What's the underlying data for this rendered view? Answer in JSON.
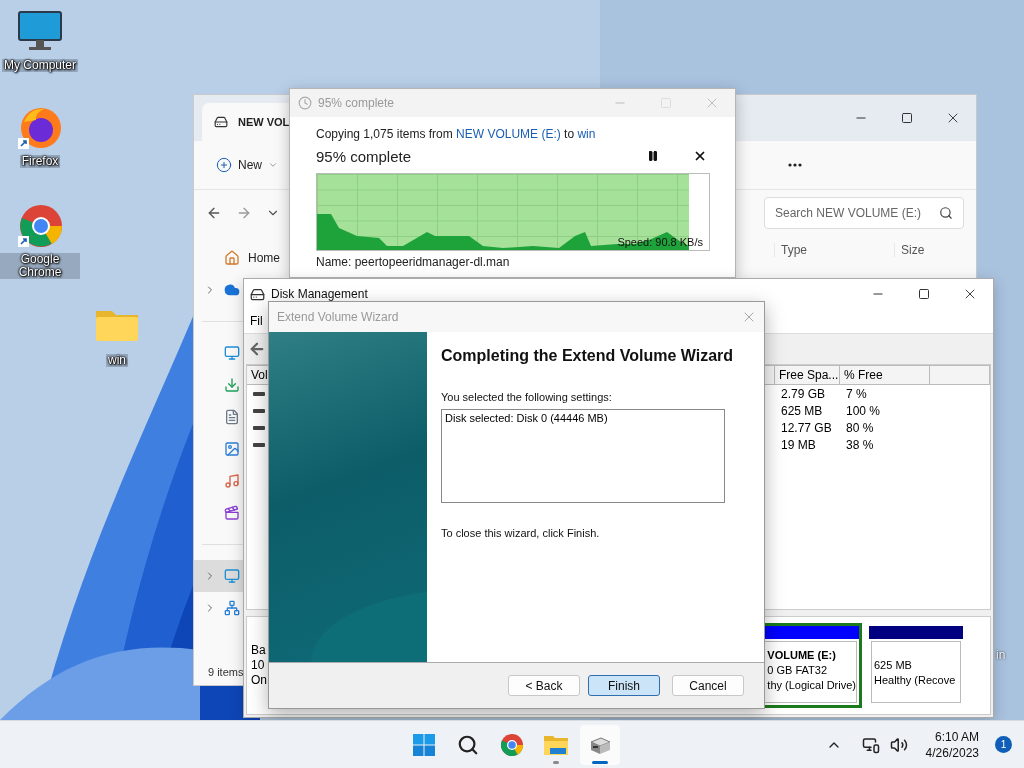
{
  "desktop": {
    "icons": [
      {
        "kind": "computer",
        "label": "My Computer",
        "shortcut": false
      },
      {
        "kind": "firefox",
        "label": "Firefox",
        "shortcut": true
      },
      {
        "kind": "chrome",
        "label": "Google Chrome",
        "shortcut": true
      },
      {
        "kind": "folder",
        "label": "win",
        "shortcut": false
      }
    ],
    "edge_label": "in"
  },
  "explorer": {
    "tab": "NEW VOL",
    "new_button": "New",
    "search": {
      "placeholder": "Search NEW VOLUME (E:)"
    },
    "columns": [
      "Type",
      "Size"
    ],
    "sidebar": [
      {
        "kind": "home",
        "label": "Home",
        "expandable": false,
        "selected": false
      },
      {
        "kind": "cloud",
        "expandable": true,
        "selected": false
      },
      {
        "kind": "divider"
      },
      {
        "kind": "desktop",
        "expandable": false,
        "selected": false
      },
      {
        "kind": "downloads",
        "expandable": false,
        "selected": false
      },
      {
        "kind": "documents",
        "expandable": false,
        "selected": false
      },
      {
        "kind": "pictures",
        "expandable": false,
        "selected": false
      },
      {
        "kind": "music",
        "expandable": false,
        "selected": false
      },
      {
        "kind": "videos",
        "expandable": false,
        "selected": false
      },
      {
        "kind": "divider"
      },
      {
        "kind": "pc",
        "expandable": true,
        "selected": true
      },
      {
        "kind": "network",
        "expandable": true,
        "selected": false
      }
    ],
    "status": "9 items"
  },
  "copy_dialog": {
    "title": "95% complete",
    "summary": {
      "prefix": "Copying 1,075 items from ",
      "source": "NEW VOLUME (E:)",
      "middle": " to ",
      "target": "win"
    },
    "status": "95% complete",
    "level": 0.95,
    "speed": "Speed: 90.8 KB/s",
    "name": "Name:  peertopeeridmanager-dl.man"
  },
  "disk_management": {
    "title": "Disk Management",
    "menu": [
      "Fil"
    ],
    "columns": [
      "Vol",
      "Free Spa...",
      "% Free"
    ],
    "rows": [
      {
        "free": "2.79 GB",
        "percent": "7 %"
      },
      {
        "free": "625 MB",
        "percent": "100 %"
      },
      {
        "free": "12.77 GB",
        "percent": "80 %"
      },
      {
        "free": "19 MB",
        "percent": "38 %"
      }
    ],
    "disk": [
      "Ba",
      "10",
      "On"
    ],
    "partitions": [
      {
        "name": "VOLUME  (E:)",
        "size": "0 GB FAT32",
        "status": "thy (Logical Drive)",
        "color": "#0000ff",
        "selected": true
      },
      {
        "size": "625 MB",
        "status": "Healthy (Recove",
        "color": "#000080",
        "selected": false
      }
    ]
  },
  "wizard": {
    "title": "Extend Volume Wizard",
    "heading": "Completing the Extend Volume Wizard",
    "prompt": "You selected the following settings:",
    "settings": [
      "Disk selected: Disk 0 (44446 MB)"
    ],
    "closing": "To close this wizard, click Finish.",
    "buttons": [
      {
        "label": "< Back",
        "default": false
      },
      {
        "label": "Finish",
        "default": true
      },
      {
        "label": "Cancel",
        "default": false
      }
    ]
  },
  "taskbar": {
    "apps": [
      {
        "kind": "start",
        "running": false,
        "active": false
      },
      {
        "kind": "search",
        "running": false,
        "active": false
      },
      {
        "kind": "chrome",
        "running": false,
        "active": false
      },
      {
        "kind": "files",
        "running": true,
        "active": false
      },
      {
        "kind": "diskmgmt",
        "running": true,
        "active": true
      }
    ],
    "time": "6:10 AM",
    "date": "4/26/2023",
    "notifications": "1"
  }
}
